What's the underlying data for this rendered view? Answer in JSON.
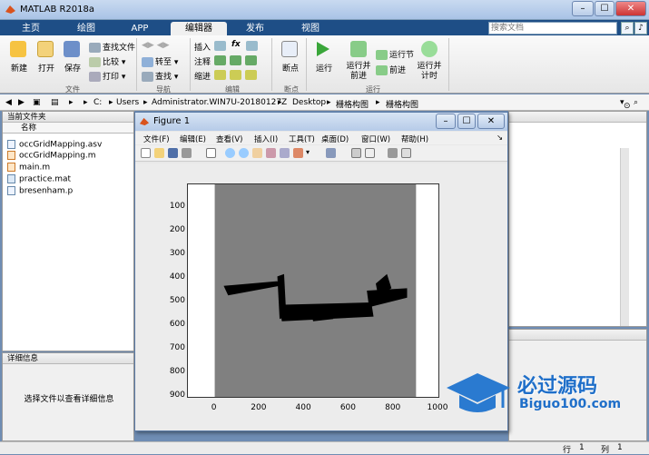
{
  "window": {
    "title": "MATLAB R2018a",
    "min": "–",
    "max": "☐",
    "close": "✕"
  },
  "tabs": [
    {
      "label": "主页",
      "active": false
    },
    {
      "label": "绘图",
      "active": false
    },
    {
      "label": "APP",
      "active": false
    },
    {
      "label": "编辑器",
      "active": true
    },
    {
      "label": "发布",
      "active": false
    },
    {
      "label": "视图",
      "active": false
    }
  ],
  "search_placeholder": "搜索文档",
  "ribbon": {
    "file_group": {
      "new": "新建",
      "open": "打开",
      "save": "保存",
      "find_files": "查找文件",
      "compare": "比较",
      "print": "打印",
      "group": "文件"
    },
    "nav_group": {
      "goto": "转至",
      "find": "查找",
      "group": "导航"
    },
    "edit_group": {
      "insert": "插入",
      "comment": "注释",
      "indent": "缩进",
      "fx": "fx",
      "group": "编辑"
    },
    "breakpoint_group": {
      "breakpoints": "断点",
      "group": "断点"
    },
    "run_group": {
      "run": "运行",
      "run_advance": "运行并前进",
      "run_section": "运行节",
      "advance": "前进",
      "run_time": "运行并计时",
      "group": "运行"
    }
  },
  "address": {
    "crumbs": [
      "C:",
      "Users",
      "Administrator.WIN7U-20180127Z",
      "Desktop",
      "栅格构图",
      "栅格构图"
    ]
  },
  "current_folder": {
    "title": "当前文件夹",
    "column": "名称",
    "files": [
      "occGridMapping.asv",
      "occGridMapping.m",
      "main.m",
      "practice.mat",
      "bresenham.p"
    ]
  },
  "details": {
    "title": "详细信息",
    "hint": "选择文件以查看详细信息"
  },
  "figure": {
    "title": "Figure 1",
    "menu": [
      "文件(F)",
      "编辑(E)",
      "查看(V)",
      "插入(I)",
      "工具(T)",
      "桌面(D)",
      "窗口(W)",
      "帮助(H)"
    ]
  },
  "chart_data": {
    "type": "heatmap",
    "title": "",
    "xlabel": "",
    "ylabel": "",
    "x_ticks": [
      "0",
      "200",
      "400",
      "600",
      "800",
      "1000"
    ],
    "y_ticks": [
      "100",
      "200",
      "300",
      "400",
      "500",
      "600",
      "700",
      "800",
      "900"
    ],
    "xlim": [
      -120,
      1000
    ],
    "ylim": [
      0,
      900
    ],
    "image_extent_x": [
      0,
      900
    ],
    "colors": {
      "unknown": "#808080",
      "occupied": "#000000",
      "margin": "#ffffff"
    }
  },
  "status": {
    "row_label": "行",
    "row": "1",
    "col_label": "列",
    "col": "1"
  },
  "watermark": {
    "cn": "必过源码",
    "en": "Biguo100.com"
  }
}
